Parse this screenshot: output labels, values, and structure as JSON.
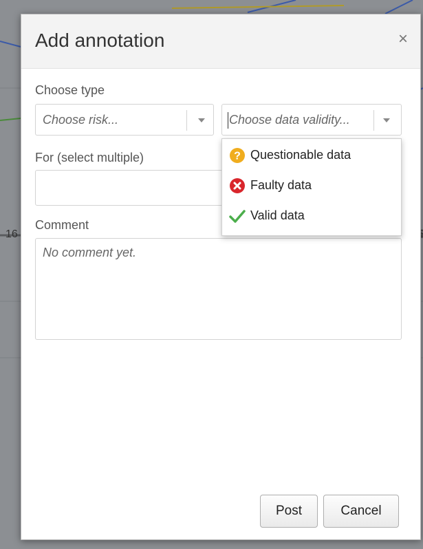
{
  "background": {
    "tick_left": "16",
    "tick_right": "$"
  },
  "dialog": {
    "title": "Add annotation",
    "close_label": "×",
    "choose_type_label": "Choose type",
    "risk_select": {
      "placeholder": "Choose risk..."
    },
    "validity_select": {
      "placeholder": "Choose data validity..."
    },
    "for_label": "For (select multiple)",
    "comment_label": "Comment",
    "comment_placeholder": "No comment yet.",
    "validity_options": [
      {
        "label": "Questionable data",
        "icon": "question-icon",
        "color": "#f0ad1e"
      },
      {
        "label": "Faulty data",
        "icon": "error-icon",
        "color": "#d9262c"
      },
      {
        "label": "Valid data",
        "icon": "check-icon",
        "color": "#4cae4c"
      }
    ],
    "buttons": {
      "post": "Post",
      "cancel": "Cancel"
    }
  }
}
